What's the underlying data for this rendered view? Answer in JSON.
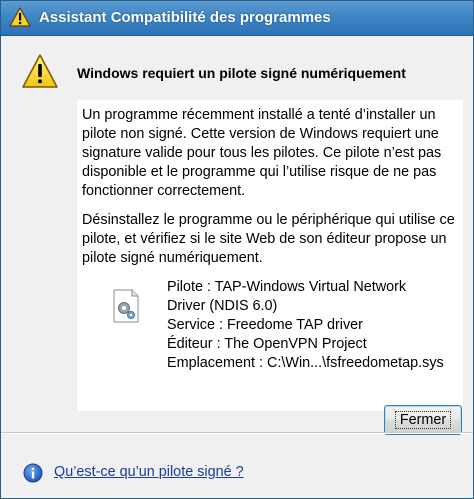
{
  "window": {
    "title": "Assistant Compatibilité des programmes"
  },
  "dialog": {
    "heading": "Windows requiert un pilote signé numériquement",
    "paragraph1": "Un programme récemment installé a tenté d’installer un pilote non signé. Cette version de Windows requiert une signature valide pour tous les pilotes. Ce pilote n’est pas disponible et le programme qui l’utilise risque de ne pas fonctionner correctement.",
    "paragraph2": "Désinstallez le programme ou le périphérique qui utilise ce pilote, et vérifiez si le site Web de son éditeur propose un pilote signé numériquement.",
    "details": {
      "driver_line1": "Pilote : TAP-Windows Virtual Network",
      "driver_line2": "Driver (NDIS 6.0)",
      "service": "Service : Freedome TAP driver",
      "publisher": "Éditeur : The OpenVPN Project",
      "location": "Emplacement : C:\\Win...\\fsfreedometap.sys"
    },
    "close_button": "Fermer",
    "help_link": "Qu’est-ce qu’un pilote signé ?"
  },
  "icons": {
    "title": "warning-icon",
    "heading": "warning-icon",
    "driver": "driver-file-icon",
    "help": "info-icon"
  }
}
